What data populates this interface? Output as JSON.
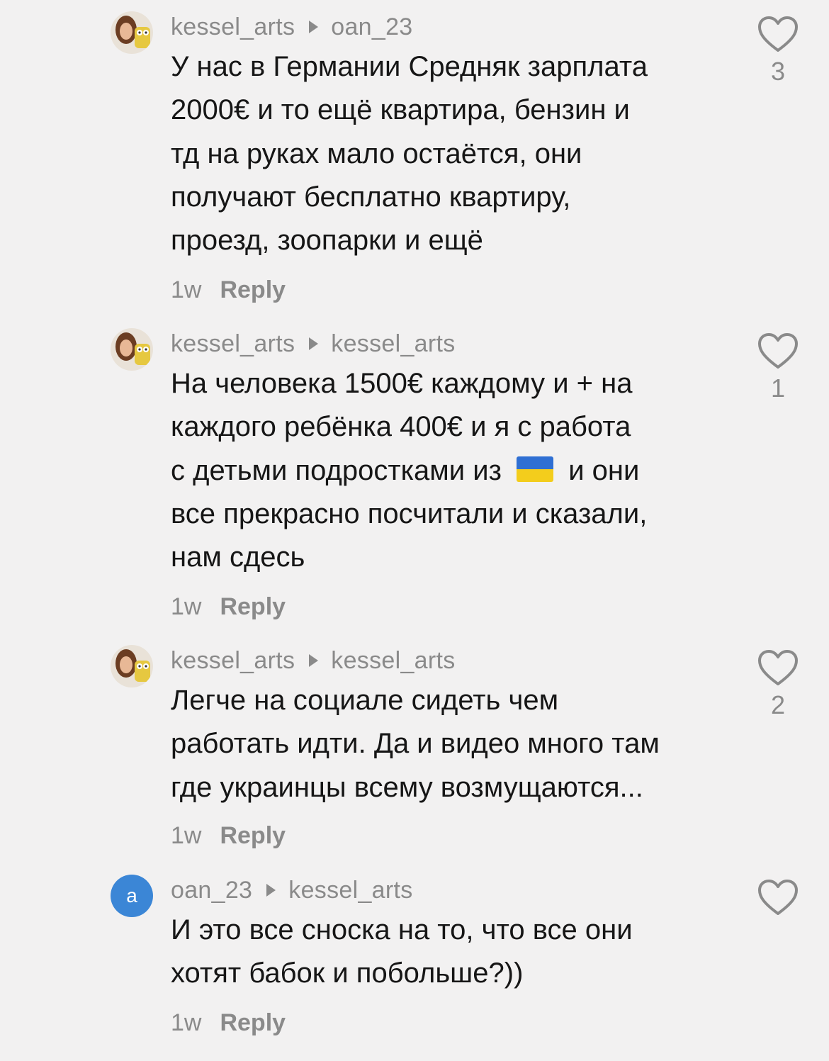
{
  "comments": [
    {
      "author": "kessel_arts",
      "reply_to": "oan_23",
      "avatar": {
        "type": "photo",
        "icon": "user-photo-avatar"
      },
      "lines": [
        "У нас в Германии Средняк зарплата",
        "2000€ и то ещё квартира, бензин и",
        "тд на руках мало остаётся, они",
        "получают бесплатно квартиру,",
        "проезд, зоопарки и ещё"
      ],
      "time": "1w",
      "reply_label": "Reply",
      "likes": "3"
    },
    {
      "author": "kessel_arts",
      "reply_to": "kessel_arts",
      "avatar": {
        "type": "photo",
        "icon": "user-photo-avatar"
      },
      "lines": [
        "На человека 1500€ каждому и + на",
        "каждого ребёнка 400€ и я с работа",
        "с детьми подростками из",
        "и они",
        "все прекрасно посчитали и сказали,",
        "нам сдесь"
      ],
      "flag": {
        "icon": "ukraine-flag-emoji",
        "top_color": "#2f6fd3",
        "bottom_color": "#f3cd1c"
      },
      "time": "1w",
      "reply_label": "Reply",
      "likes": "1"
    },
    {
      "author": "kessel_arts",
      "reply_to": "kessel_arts",
      "avatar": {
        "type": "photo",
        "icon": "user-photo-avatar"
      },
      "lines": [
        "Легче на социале сидеть чем",
        "работать идти. Да и видео много там",
        "где украинцы всему возмущаются..."
      ],
      "time": "1w",
      "reply_label": "Reply",
      "likes": "2"
    },
    {
      "author": "oan_23",
      "reply_to": "kessel_arts",
      "avatar": {
        "type": "letter",
        "letter": "a",
        "color": "#3b86d6"
      },
      "lines": [
        "И это все сноска на то, что все они",
        "хотят бабок и побольше?))"
      ],
      "time": "1w",
      "reply_label": "Reply",
      "likes": ""
    }
  ]
}
